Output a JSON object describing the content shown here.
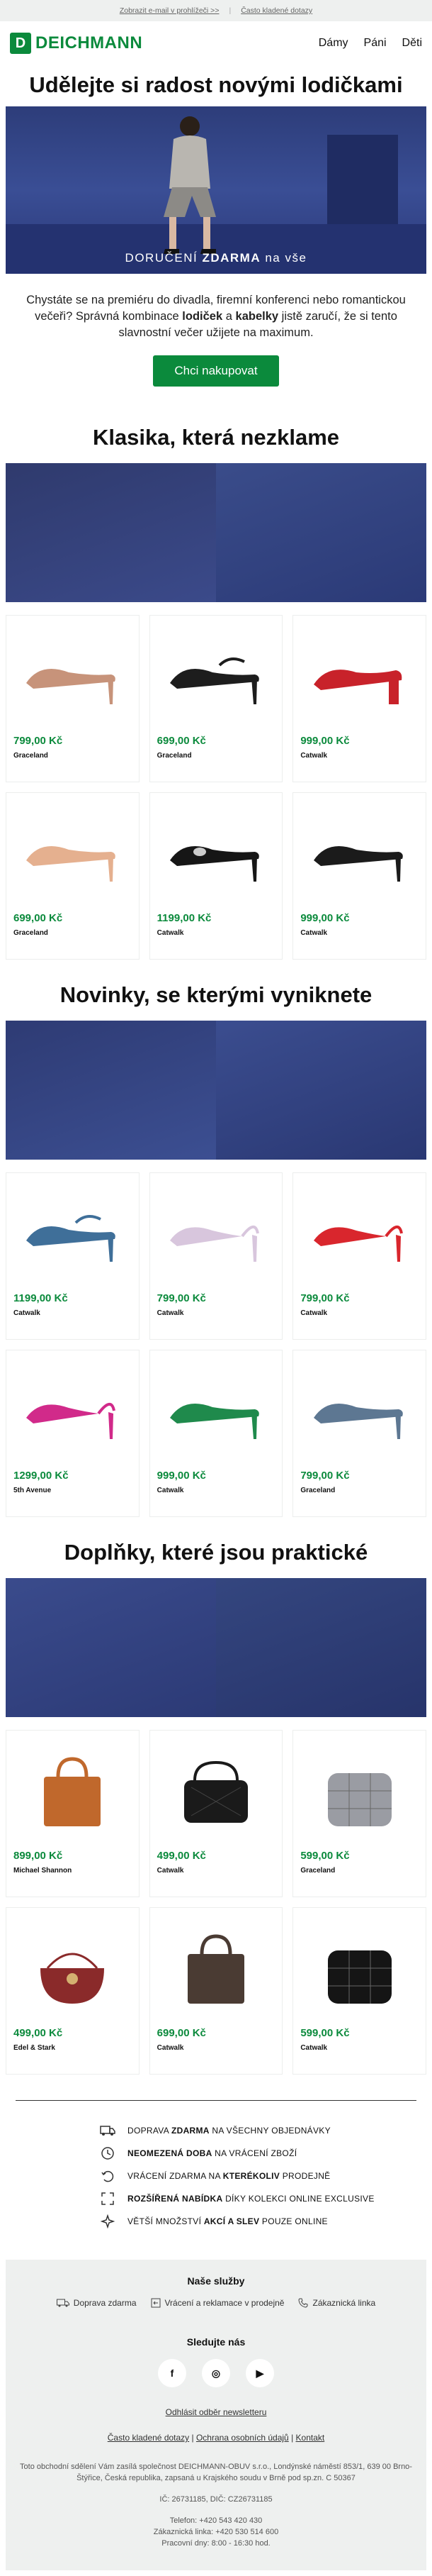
{
  "topbar": {
    "view_online": "Zobrazit e-mail v prohlížeči >>",
    "faq": "Často kladené dotazy"
  },
  "header": {
    "logo_text": "DEICHMANN",
    "logo_letter": "D",
    "nav": [
      "Dámy",
      "Páni",
      "Děti"
    ]
  },
  "hero": {
    "title": "Udělejte si radost novými lodičkami",
    "banner_pre": "DORUČENÍ",
    "banner_bold": "ZDARMA",
    "banner_post": "na vše"
  },
  "intro": {
    "line1": "Chystáte se na premiéru do divadla, firemní konferenci nebo romantickou večeři? Správná kombinace",
    "bold1": "lodiček",
    "and": "a",
    "bold2": "kabelky",
    "line2": "jistě zaručí, že si tento slavnostní večer užijete na maximum."
  },
  "cta": "Chci nakupovat",
  "sections": [
    {
      "title": "Klasika, která nezklame",
      "products": [
        {
          "price": "799,00 Kč",
          "brand": "Graceland",
          "color": "#c7937a",
          "kind": "pump"
        },
        {
          "price": "699,00 Kč",
          "brand": "Graceland",
          "color": "#1d1d1d",
          "kind": "strap"
        },
        {
          "price": "999,00 Kč",
          "brand": "Catwalk",
          "color": "#c8222a",
          "kind": "block"
        },
        {
          "price": "699,00 Kč",
          "brand": "Graceland",
          "color": "#e5b08f",
          "kind": "pump"
        },
        {
          "price": "1199,00 Kč",
          "brand": "Catwalk",
          "color": "#161616",
          "kind": "jewel"
        },
        {
          "price": "999,00 Kč",
          "brand": "Catwalk",
          "color": "#1b1b1b",
          "kind": "pump"
        }
      ]
    },
    {
      "title": "Novinky, se kterými vyniknete",
      "products": [
        {
          "price": "1199,00 Kč",
          "brand": "Catwalk",
          "color": "#3f6f99",
          "kind": "strap"
        },
        {
          "price": "799,00 Kč",
          "brand": "Catwalk",
          "color": "#d8c6dd",
          "kind": "sling"
        },
        {
          "price": "799,00 Kč",
          "brand": "Catwalk",
          "color": "#d9262d",
          "kind": "sling"
        },
        {
          "price": "1299,00 Kč",
          "brand": "5th Avenue",
          "color": "#d12a8a",
          "kind": "sling"
        },
        {
          "price": "999,00 Kč",
          "brand": "Catwalk",
          "color": "#1f8a4c",
          "kind": "pump"
        },
        {
          "price": "799,00 Kč",
          "brand": "Graceland",
          "color": "#5d7792",
          "kind": "pump"
        }
      ]
    },
    {
      "title": "Doplňky, které jsou praktické",
      "products": [
        {
          "price": "899,00 Kč",
          "brand": "Michael Shannon",
          "color": "#c0682c",
          "kind": "tote"
        },
        {
          "price": "499,00 Kč",
          "brand": "Catwalk",
          "color": "#1a1a1a",
          "kind": "quilt"
        },
        {
          "price": "599,00 Kč",
          "brand": "Graceland",
          "color": "#9a9ca3",
          "kind": "puffer"
        },
        {
          "price": "499,00 Kč",
          "brand": "Edel & Stark",
          "color": "#8a2a2a",
          "kind": "round"
        },
        {
          "price": "699,00 Kč",
          "brand": "Catwalk",
          "color": "#4a3b33",
          "kind": "tote"
        },
        {
          "price": "599,00 Kč",
          "brand": "Catwalk",
          "color": "#151515",
          "kind": "puffer"
        }
      ]
    }
  ],
  "benefits": [
    {
      "icon": "truck-icon",
      "pre": "DOPRAVA ",
      "bold": "ZDARMA",
      "post": " NA VŠECHNY OBJEDNÁVKY"
    },
    {
      "icon": "clock-icon",
      "pre": "",
      "bold": "NEOMEZENÁ DOBA",
      "post": " NA VRÁCENÍ ZBOŽÍ"
    },
    {
      "icon": "return-icon",
      "pre": "VRÁCENÍ ZDARMA NA ",
      "bold": "KTERÉKOLIV",
      "post": " PRODEJNĚ"
    },
    {
      "icon": "expand-icon",
      "pre": "",
      "bold": "ROZŠÍŘENÁ NABÍDKA",
      "post": " DÍKY KOLEKCI ONLINE EXCLUSIVE"
    },
    {
      "icon": "sparkle-icon",
      "pre": "VĚTŠÍ MNOŽSTVÍ ",
      "bold": "AKCÍ A SLEV",
      "post": " POUZE ONLINE"
    }
  ],
  "footer": {
    "services_title": "Naše služby",
    "services": [
      "Doprava zdarma",
      "Vrácení a reklamace v prodejně",
      "Zákaznická linka"
    ],
    "social_title": "Sledujte nás",
    "socials": [
      "f",
      "◎",
      "▶"
    ],
    "unsubscribe": "Odhlásit odběr newsletteru",
    "links": [
      "Často kladené dotazy",
      "Ochrana osobních údajů",
      "Kontakt"
    ],
    "legal1": "Toto obchodní sdělení Vám zasílá společnost DEICHMANN-OBUV s.r.o., Londýnské náměstí 853/1, 639 00 Brno-Štýřice, Česká republika, zapsaná u Krajského soudu v Brně pod sp.zn. C 50367",
    "legal2": "IČ: 26731185, DIČ: CZ26731185",
    "legal3": "Telefon: +420 543 420 430",
    "legal4": "Zákaznická linka: +420 530 514 600",
    "legal5": "Pracovní dny: 8:00 - 16:30 hod."
  }
}
